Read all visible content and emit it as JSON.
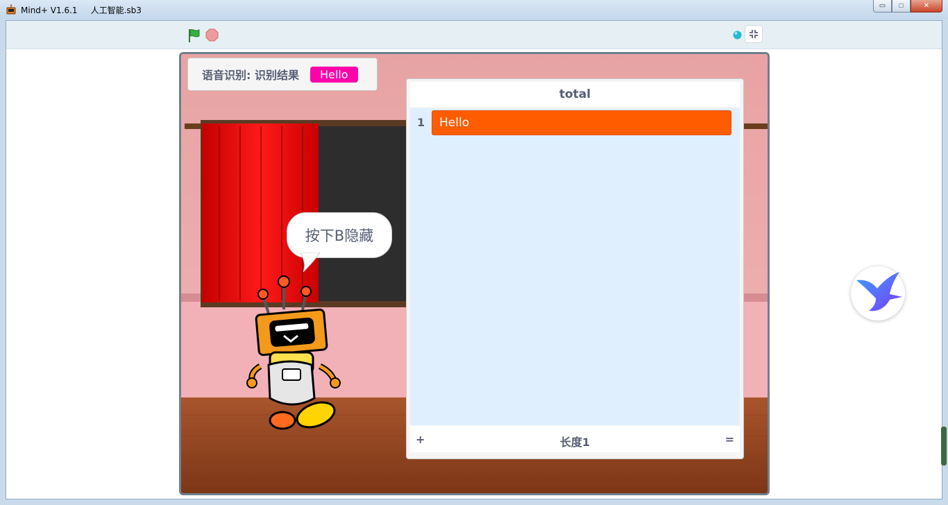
{
  "window": {
    "title": "Mind+ V1.6.1     人工智能.sb3",
    "minimize_glyph": "▭",
    "maximize_glyph": "□",
    "close_glyph": "✕"
  },
  "toolbar": {
    "green_flag_icon": "green-flag-icon",
    "stop_icon": "stop-icon",
    "fullscreen_icon": "exit-fullscreen-icon"
  },
  "stage": {
    "variable_monitor": {
      "label": "语音识别: 识别结果",
      "value": "Hello",
      "value_color": "#ff00aa"
    },
    "speech_bubble": "按下B隐藏",
    "list_monitor": {
      "title": "total",
      "items": [
        {
          "index": "1",
          "value": "Hello"
        }
      ],
      "add_glyph": "+",
      "length_label": "长度1",
      "resize_glyph": "="
    }
  },
  "colors": {
    "list_item": "#ff5c00",
    "list_body": "#e0effe",
    "text": "#575e75"
  }
}
